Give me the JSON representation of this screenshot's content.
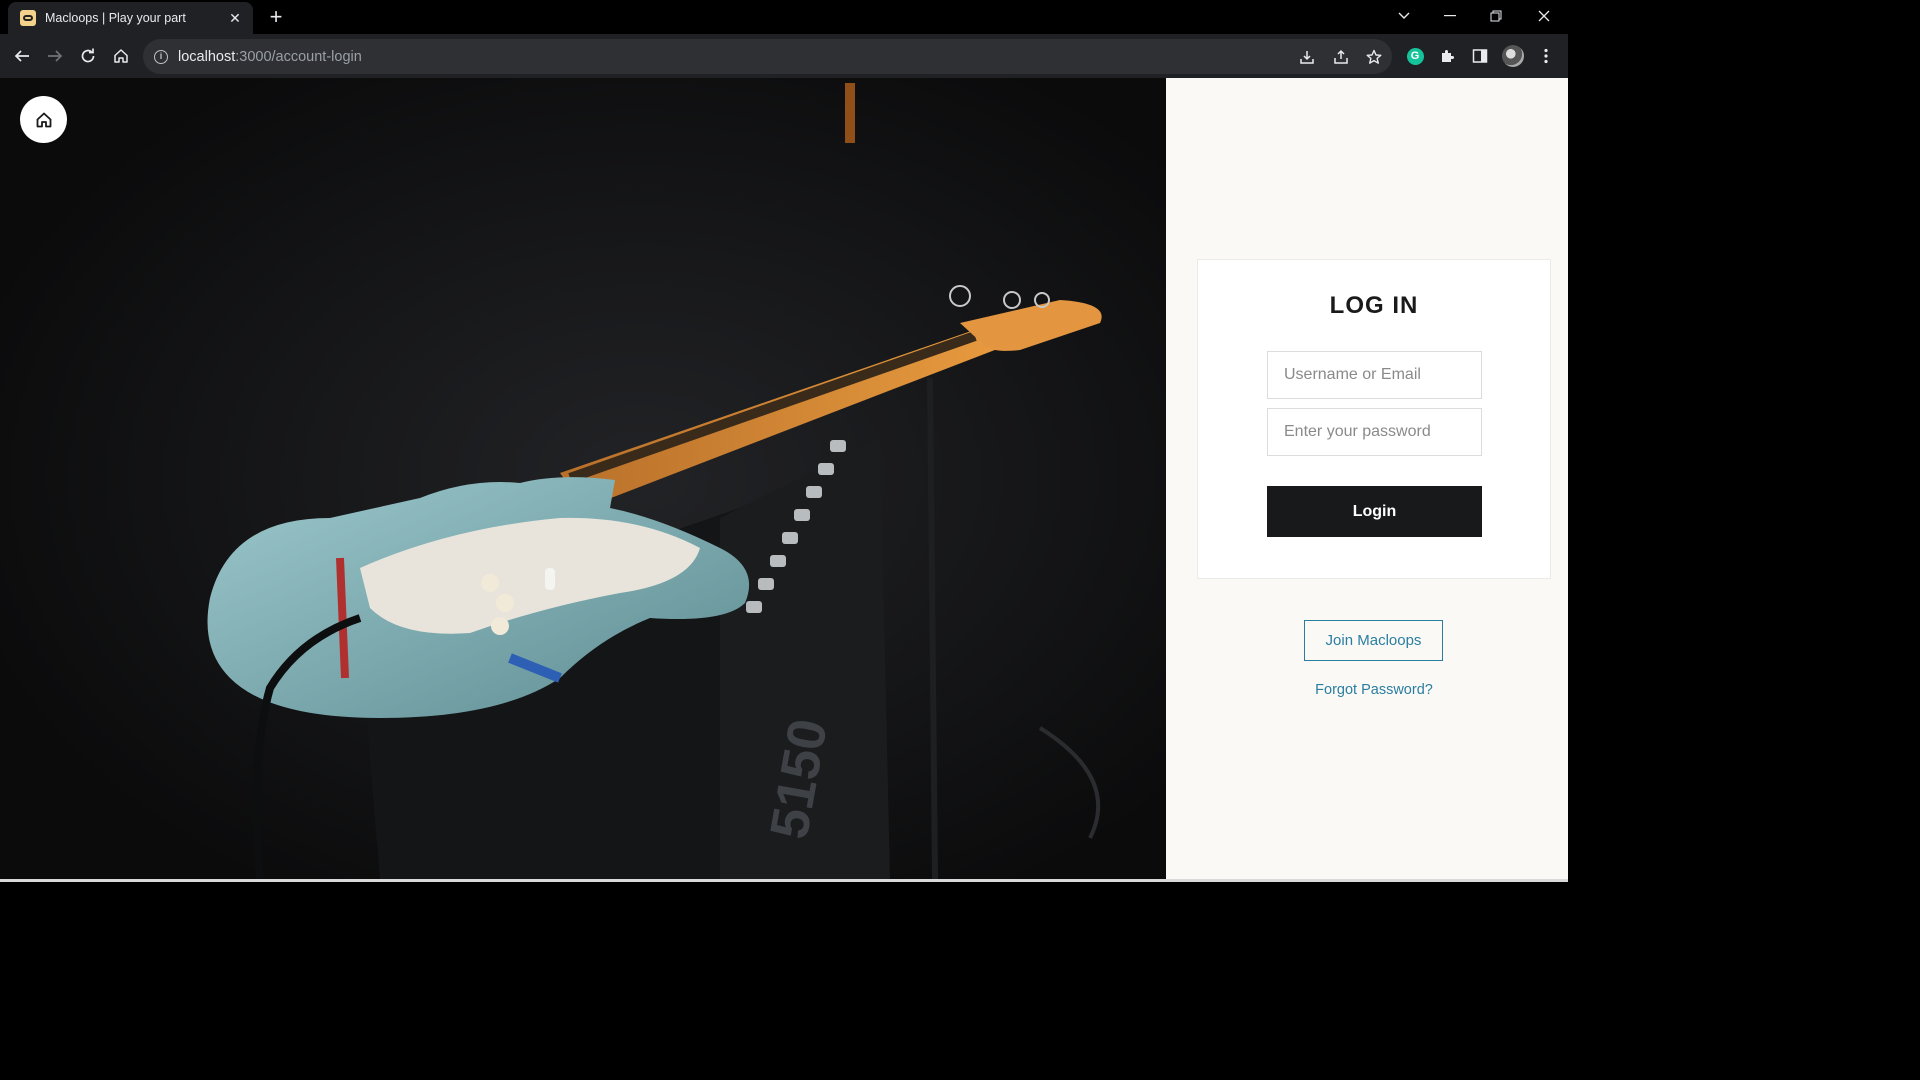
{
  "browser": {
    "tab_title": "Macloops | Play your part",
    "url_host": "localhost",
    "url_path": ":3000/account-login",
    "colors": {
      "frame": "#000000",
      "toolbar": "#202124",
      "omnibox": "#2f3033"
    }
  },
  "hero": {
    "image_description_icon": "guitar-on-amplifier-photo",
    "home_icon": "home-icon"
  },
  "login": {
    "title": "LOG IN",
    "username_placeholder": "Username or Email",
    "password_placeholder": "Enter your password",
    "login_label": "Login",
    "join_label": "Join Macloops",
    "forgot_label": "Forgot Password?"
  },
  "colors": {
    "panel_bg": "#faf9f6",
    "button_dark": "#17191b",
    "link_accent": "#2a7ea0"
  }
}
